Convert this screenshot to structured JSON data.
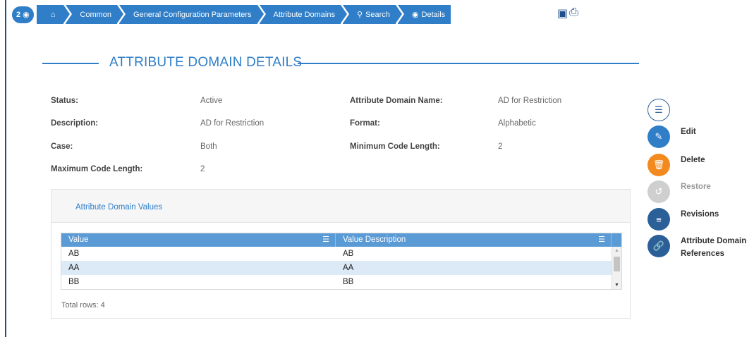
{
  "breadcrumb": {
    "counter": "2",
    "items": [
      {
        "label": ""
      },
      {
        "label": "Common"
      },
      {
        "label": "General Configuration Parameters"
      },
      {
        "label": "Attribute Domains"
      },
      {
        "label": "Search"
      },
      {
        "label": "Details"
      }
    ]
  },
  "heading": "ATTRIBUTE DOMAIN DETAILS",
  "fields": {
    "status": {
      "label": "Status:",
      "value": "Active"
    },
    "description": {
      "label": "Description:",
      "value": "AD for Restriction"
    },
    "case": {
      "label": "Case:",
      "value": "Both"
    },
    "max_length": {
      "label": "Maximum Code Length:",
      "value": "2"
    },
    "name": {
      "label": "Attribute Domain Name:",
      "value": "AD for Restriction"
    },
    "format": {
      "label": "Format:",
      "value": "Alphabetic"
    },
    "min_length": {
      "label": "Minimum Code Length:",
      "value": "2"
    }
  },
  "values_panel": {
    "title": "Attribute Domain Values",
    "columns": [
      "Value",
      "Value Description"
    ],
    "rows": [
      [
        "AB",
        "AB"
      ],
      [
        "AA",
        "AA"
      ],
      [
        "BB",
        "BB"
      ]
    ],
    "total": "Total rows: 4"
  },
  "actions": {
    "edit": "Edit",
    "delete": "Delete",
    "restore": "Restore",
    "revisions": "Revisions",
    "references_line1": "Attribute Domain",
    "references_line2": "References"
  },
  "colors": {
    "accent": "#2f7ec7",
    "grid_header": "#5b9bd5",
    "delete": "#f28a1f",
    "disabled": "#cfcfcf"
  }
}
